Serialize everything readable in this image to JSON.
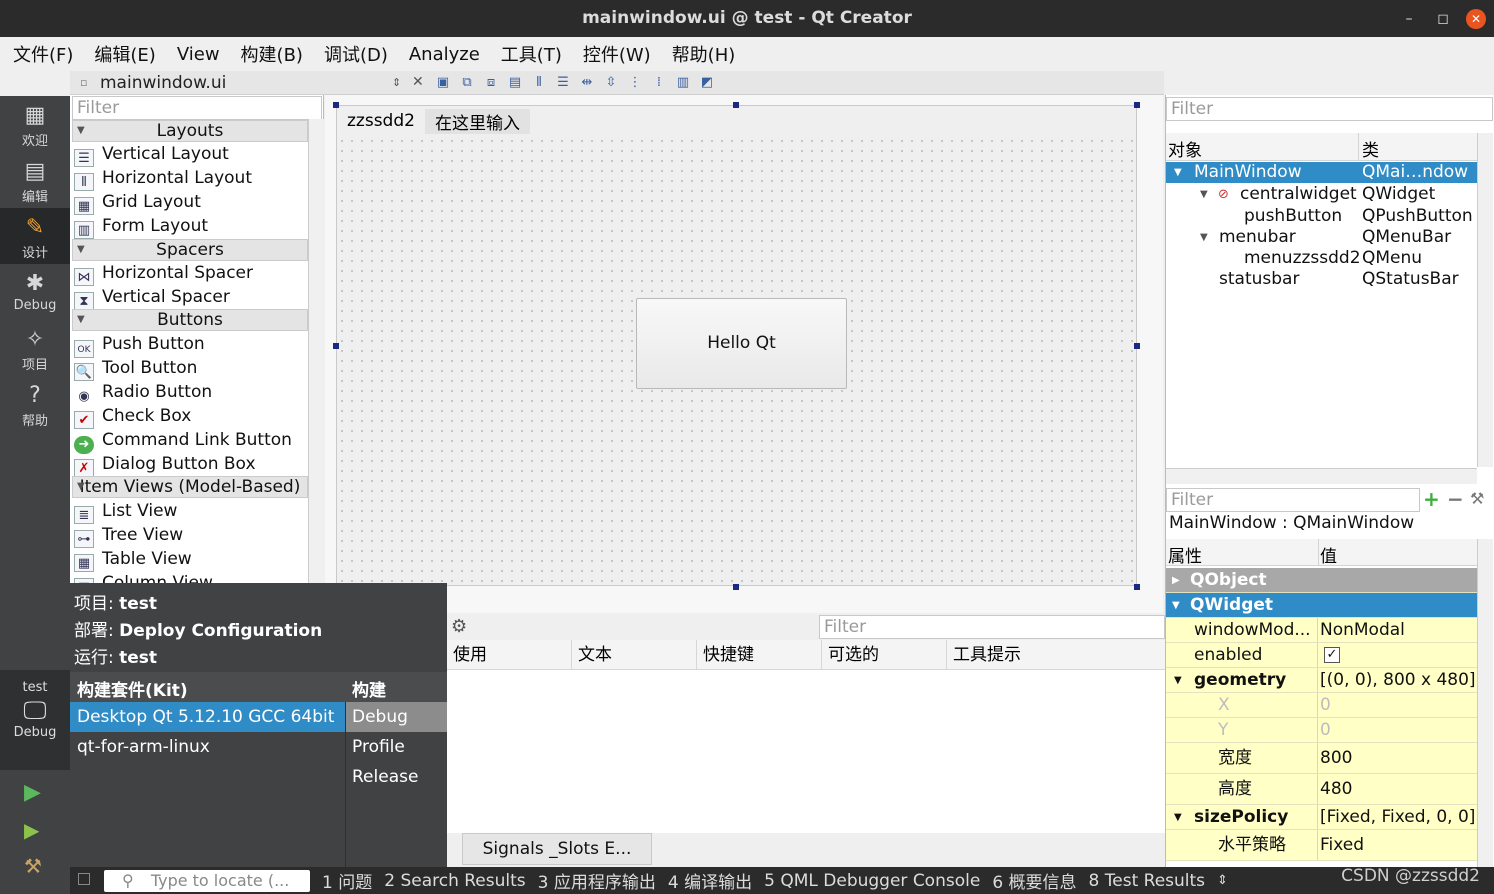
{
  "window": {
    "title": "mainwindow.ui @ test - Qt Creator",
    "min": "–",
    "max": "◻",
    "close": "✕"
  },
  "menu": [
    "文件(F)",
    "编辑(E)",
    "View",
    "构建(B)",
    "调试(D)",
    "Analyze",
    "工具(T)",
    "控件(W)",
    "帮助(H)"
  ],
  "sidebar": {
    "items": [
      {
        "label": "欢迎",
        "icon": "grid-icon",
        "glyph": "▦"
      },
      {
        "label": "编辑",
        "icon": "document-icon",
        "glyph": "▤"
      },
      {
        "label": "设计",
        "icon": "pencil-icon",
        "glyph": "✎"
      },
      {
        "label": "Debug",
        "icon": "bug-icon",
        "glyph": "✱"
      },
      {
        "label": "项目",
        "icon": "wrench-icon",
        "glyph": "✧"
      },
      {
        "label": "帮助",
        "icon": "help-icon",
        "glyph": "?"
      }
    ],
    "kit": {
      "project": "test",
      "mode": "Debug"
    }
  },
  "editor": {
    "file_name": "mainwindow.ui"
  },
  "widgetbox": {
    "filter_placeholder": "Filter",
    "categories": {
      "layouts": "Layouts",
      "spacers": "Spacers",
      "buttons": "Buttons",
      "itemviews": "Item Views (Model-Based)"
    },
    "layouts": [
      "Vertical Layout",
      "Horizontal Layout",
      "Grid Layout",
      "Form Layout"
    ],
    "spacers": [
      "Horizontal Spacer",
      "Vertical Spacer"
    ],
    "buttons": [
      "Push Button",
      "Tool Button",
      "Radio Button",
      "Check Box",
      "Command Link Button",
      "Dialog Button Box"
    ],
    "itemviews": [
      "List View",
      "Tree View",
      "Table View",
      "Column View"
    ]
  },
  "form": {
    "menus": [
      "zzssdd2",
      "在这里输入"
    ],
    "button_text": "Hello Qt"
  },
  "actions": {
    "filter_placeholder": "Filter",
    "columns": [
      "使用",
      "文本",
      "快捷键",
      "可选的",
      "工具提示"
    ],
    "tab": "Signals _Slots E..."
  },
  "objects": {
    "filter_placeholder": "Filter",
    "headers": [
      "对象",
      "类"
    ],
    "rows": [
      {
        "name": "MainWindow",
        "cls": "QMai…ndow"
      },
      {
        "name": "centralwidget",
        "cls": "QWidget"
      },
      {
        "name": "pushButton",
        "cls": "QPushButton"
      },
      {
        "name": "menubar",
        "cls": "QMenuBar"
      },
      {
        "name": "menuzzssdd2",
        "cls": "QMenu"
      },
      {
        "name": "statusbar",
        "cls": "QStatusBar"
      }
    ]
  },
  "properties": {
    "filter_placeholder": "Filter",
    "context": "MainWindow : QMainWindow",
    "headers": [
      "属性",
      "值"
    ],
    "rows": [
      {
        "k": "QObject",
        "v": ""
      },
      {
        "k": "QWidget",
        "v": ""
      },
      {
        "k": "windowMod...",
        "v": "NonModal"
      },
      {
        "k": "enabled",
        "v": "✓"
      },
      {
        "k": "geometry",
        "v": "[(0, 0), 800 x 480]"
      },
      {
        "k": "X",
        "v": "0"
      },
      {
        "k": "Y",
        "v": "0"
      },
      {
        "k": "宽度",
        "v": "800"
      },
      {
        "k": "高度",
        "v": "480"
      },
      {
        "k": "sizePolicy",
        "v": "[Fixed, Fixed, 0, 0]"
      },
      {
        "k": "水平策略",
        "v": "Fixed"
      }
    ]
  },
  "popup": {
    "project_label": "项目:",
    "project": "test",
    "deploy_label": "部署:",
    "deploy": "Deploy Configuration",
    "run_label": "运行:",
    "run": "test",
    "kit_header": "构建套件(Kit)",
    "build_header": "构建",
    "kits": [
      "Desktop Qt 5.12.10 GCC 64bit",
      "qt-for-arm-linux"
    ],
    "builds": [
      "Debug",
      "Profile",
      "Release"
    ]
  },
  "statusbar": {
    "locate_placeholder": "Type to locate (...",
    "panes": [
      "1 问题",
      "2 Search Results",
      "3 应用程序输出",
      "4 编译输出",
      "5 QML Debugger Console",
      "6 概要信息",
      "8 Test Results"
    ]
  },
  "watermark": "CSDN @zzssdd2",
  "colors": {
    "selection": "#308cc6",
    "sidebar": "#404244",
    "property_bg": "#ffffc6"
  }
}
